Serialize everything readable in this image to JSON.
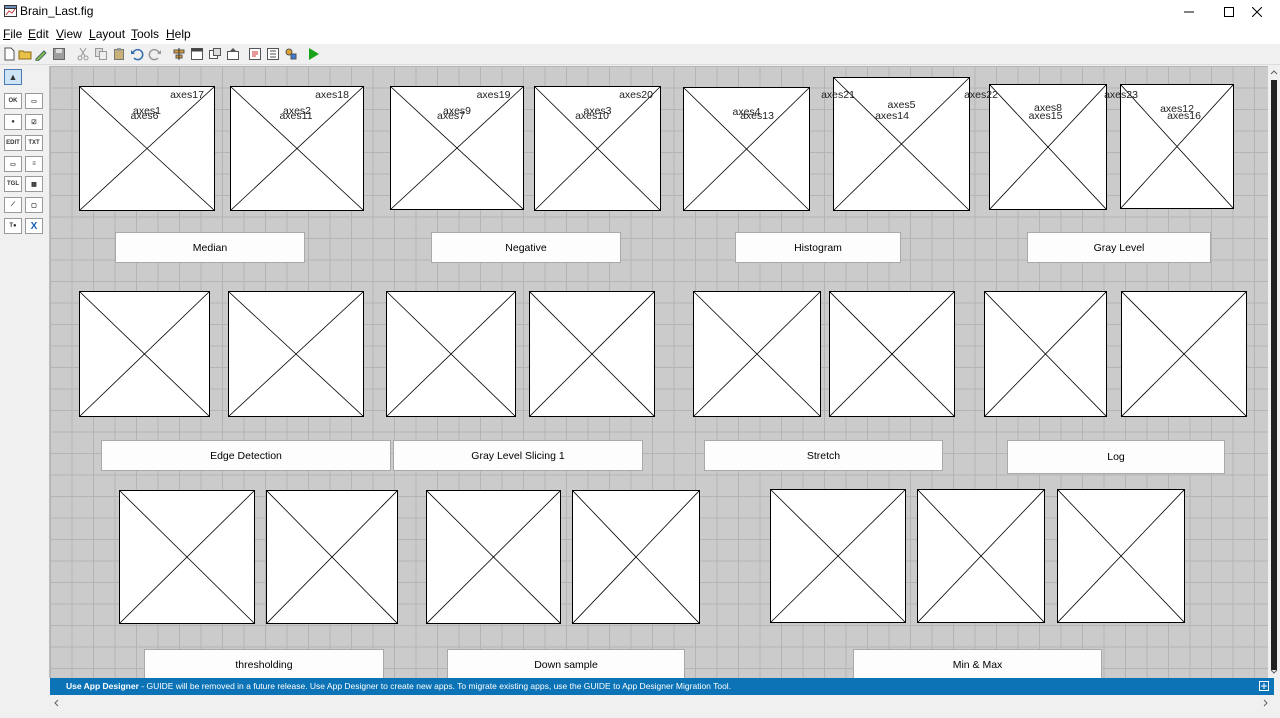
{
  "window": {
    "title": "Brain_Last.fig"
  },
  "menu": [
    {
      "label": "File",
      "u": "F",
      "rest": "ile"
    },
    {
      "label": "Edit",
      "u": "E",
      "rest": "dit"
    },
    {
      "label": "View",
      "u": "V",
      "rest": "iew"
    },
    {
      "label": "Layout",
      "u": "L",
      "rest": "ayout"
    },
    {
      "label": "Tools",
      "u": "T",
      "rest": "ools"
    },
    {
      "label": "Help",
      "u": "H",
      "rest": "elp"
    }
  ],
  "palette": {
    "items": [
      {
        "name": "select-tool",
        "glyph": "▲"
      },
      {
        "name": "pushbutton-tool",
        "glyph": "OK"
      },
      {
        "name": "slider-tool",
        "glyph": "▭"
      },
      {
        "name": "radio-tool",
        "glyph": "●"
      },
      {
        "name": "checkbox-tool",
        "glyph": "☑"
      },
      {
        "name": "edit-text-tool",
        "glyph": "EDIT"
      },
      {
        "name": "static-text-tool",
        "glyph": "TXT"
      },
      {
        "name": "popup-tool",
        "glyph": "▭"
      },
      {
        "name": "listbox-tool",
        "glyph": "≡"
      },
      {
        "name": "toggle-tool",
        "glyph": "TGL"
      },
      {
        "name": "table-tool",
        "glyph": "▦"
      },
      {
        "name": "axes-tool",
        "glyph": "⟋"
      },
      {
        "name": "panel-tool",
        "glyph": "▢"
      },
      {
        "name": "buttongroup-tool",
        "glyph": "T●"
      },
      {
        "name": "activex-tool",
        "glyph": "X"
      }
    ]
  },
  "axes": [
    {
      "label": "axes1"
    },
    {
      "label": "axes2"
    },
    {
      "label": "axes9"
    },
    {
      "label": "axes3"
    },
    {
      "label": "axes4"
    },
    {
      "label": "axes5"
    },
    {
      "label": "axes8"
    },
    {
      "label": "axes12"
    },
    {
      "label": "axes6"
    },
    {
      "label": "axes11"
    },
    {
      "label": "axes7"
    },
    {
      "label": "axes10"
    },
    {
      "label": "axes13"
    },
    {
      "label": "axes14"
    },
    {
      "label": "axes15"
    },
    {
      "label": "axes16"
    },
    {
      "label": "axes17"
    },
    {
      "label": "axes18"
    },
    {
      "label": "axes19"
    },
    {
      "label": "axes20"
    },
    {
      "label": "axes21"
    },
    {
      "label": "axes22"
    },
    {
      "label": "axes23"
    }
  ],
  "buttons": [
    {
      "label": "Median"
    },
    {
      "label": "Negative"
    },
    {
      "label": "Histogram"
    },
    {
      "label": "Gray Level"
    },
    {
      "label": "Edge Detection"
    },
    {
      "label": "Gray Level Slicing 1"
    },
    {
      "label": "Stretch"
    },
    {
      "label": "Log"
    },
    {
      "label": "thresholding"
    },
    {
      "label": "Down sample"
    },
    {
      "label": "Min & Max"
    }
  ],
  "banner": {
    "bold": "Use App Designer",
    "text": " - GUIDE will be removed in a future release. Use App Designer to create new apps. To migrate existing apps, use the GUIDE to App Designer Migration Tool."
  },
  "colors": {
    "banner": "#0b73b6",
    "canvas": "#cbcbcb",
    "grid": "#b4b4b4",
    "run": "#1aa31a"
  }
}
